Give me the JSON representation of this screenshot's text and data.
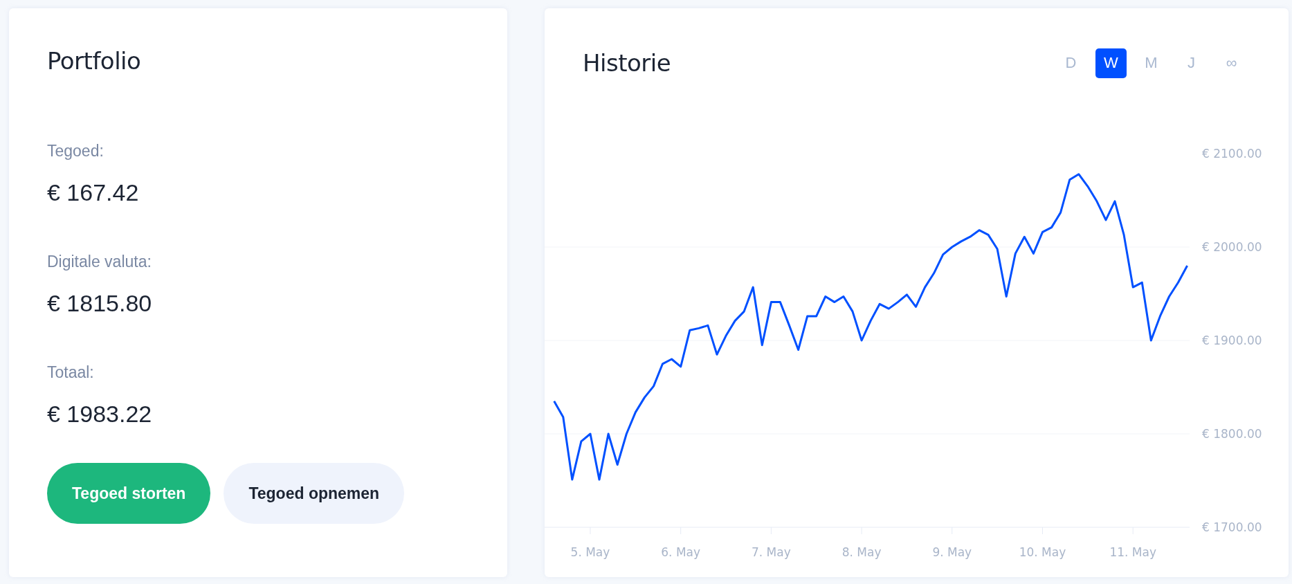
{
  "portfolio": {
    "title": "Portfolio",
    "items": [
      {
        "label": "Tegoed:",
        "value": "€ 167.42"
      },
      {
        "label": "Digitale valuta:",
        "value": "€ 1815.80"
      },
      {
        "label": "Totaal:",
        "value": "€ 1983.22"
      }
    ],
    "buttons": [
      {
        "label": "Tegoed storten",
        "kind": "primary"
      },
      {
        "label": "Tegoed opnemen",
        "kind": "secondary"
      }
    ]
  },
  "history": {
    "title": "Historie",
    "periods": [
      {
        "label": "D",
        "selected": false
      },
      {
        "label": "W",
        "selected": true
      },
      {
        "label": "M",
        "selected": false
      },
      {
        "label": "J",
        "selected": false
      },
      {
        "label": "∞",
        "selected": false
      }
    ],
    "chart_data": {
      "type": "line",
      "grid": true,
      "ylim": [
        1700,
        2100
      ],
      "categories": [
        null,
        null,
        null,
        null,
        "5. May",
        null,
        null,
        null,
        null,
        null,
        null,
        null,
        null,
        null,
        "6. May",
        null,
        null,
        null,
        null,
        null,
        null,
        null,
        null,
        null,
        "7. May",
        null,
        null,
        null,
        null,
        null,
        null,
        null,
        null,
        null,
        "8. May",
        null,
        null,
        null,
        null,
        null,
        null,
        null,
        null,
        null,
        "9. May",
        null,
        null,
        null,
        null,
        null,
        null,
        null,
        null,
        null,
        "10. May",
        null,
        null,
        null,
        null,
        null,
        null,
        null,
        null,
        null,
        "11. May",
        null,
        null,
        null,
        null,
        null,
        null
      ],
      "series": [
        {
          "color": "#0050ff",
          "values": [
            1835,
            1818,
            1751,
            1792,
            1800,
            1751,
            1800,
            1767,
            1800,
            1823,
            1839,
            1851,
            1875,
            1880,
            1872,
            1911,
            1913,
            1916,
            1885,
            1905,
            1921,
            1931,
            1957,
            1895,
            1941,
            1941,
            1916,
            1890,
            1926,
            1926,
            1947,
            1941,
            1947,
            1931,
            1900,
            1921,
            1939,
            1934,
            1941,
            1949,
            1936,
            1957,
            1972,
            1992,
            2000,
            2006,
            2011,
            2018,
            2013,
            1998,
            1947,
            1993,
            2011,
            1993,
            2016,
            2021,
            2037,
            2072,
            2078,
            2065,
            2049,
            2029,
            2049,
            2013,
            1957,
            1962,
            1900,
            1926,
            1947,
            1962,
            1980
          ]
        }
      ],
      "yticks": [
        {
          "value": 1700,
          "label": "€ 1700.00"
        },
        {
          "value": 1800,
          "label": "€ 1800.00"
        },
        {
          "value": 1900,
          "label": "€ 1900.00"
        },
        {
          "value": 2000,
          "label": "€ 2000.00"
        },
        {
          "value": 2100,
          "label": "€ 2100.00"
        }
      ]
    }
  }
}
